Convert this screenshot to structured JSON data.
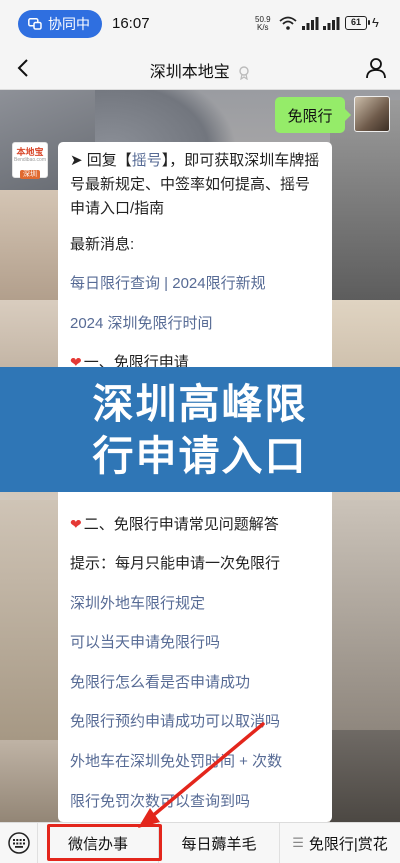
{
  "status_bar": {
    "sync_label": "协同中",
    "time": "16:07",
    "net_speed_value": "50.9",
    "net_speed_unit": "K/s",
    "battery": "61"
  },
  "nav": {
    "title": "深圳本地宝"
  },
  "messages": {
    "user_message": "免限行",
    "bot_avatar": {
      "brand": "本地宝",
      "brand_sub": "Bendibao.com",
      "brand_city": "深圳"
    },
    "bot_intro_prefix": "➤ 回复【",
    "bot_intro_keyword": "摇号",
    "bot_intro_suffix": "】，即可获取深圳车牌摇号最新规定、中签率如何提高、摇号申请入口/指南",
    "latest_news_label": "最新消息:",
    "links_top": [
      "每日限行查询 | 2024限行新规",
      "2024 深圳免限行时间"
    ],
    "section1_title": "一、免限行申请",
    "section2_title": "二、免限行申请常见问题解答",
    "tip": "提示：每月只能申请一次免限行",
    "links_bottom": [
      "深圳外地车限行规定",
      "可以当天申请免限行吗",
      "免限行怎么看是否申请成功",
      "免限行预约申请成功可以取消吗",
      "外地车在深圳免处罚时间 + 次数",
      "限行免罚次数可以查询到吗"
    ]
  },
  "banner": {
    "line1": "深圳高峰限",
    "line2": "行申请入口"
  },
  "bottom_menu": {
    "items": [
      "微信办事",
      "每日薅羊毛",
      "免限行|赏花"
    ]
  },
  "colors": {
    "accent_blue": "#2f76b6",
    "link": "#576b95",
    "highlight_red": "#e3261c",
    "my_bubble": "#95ec69"
  }
}
